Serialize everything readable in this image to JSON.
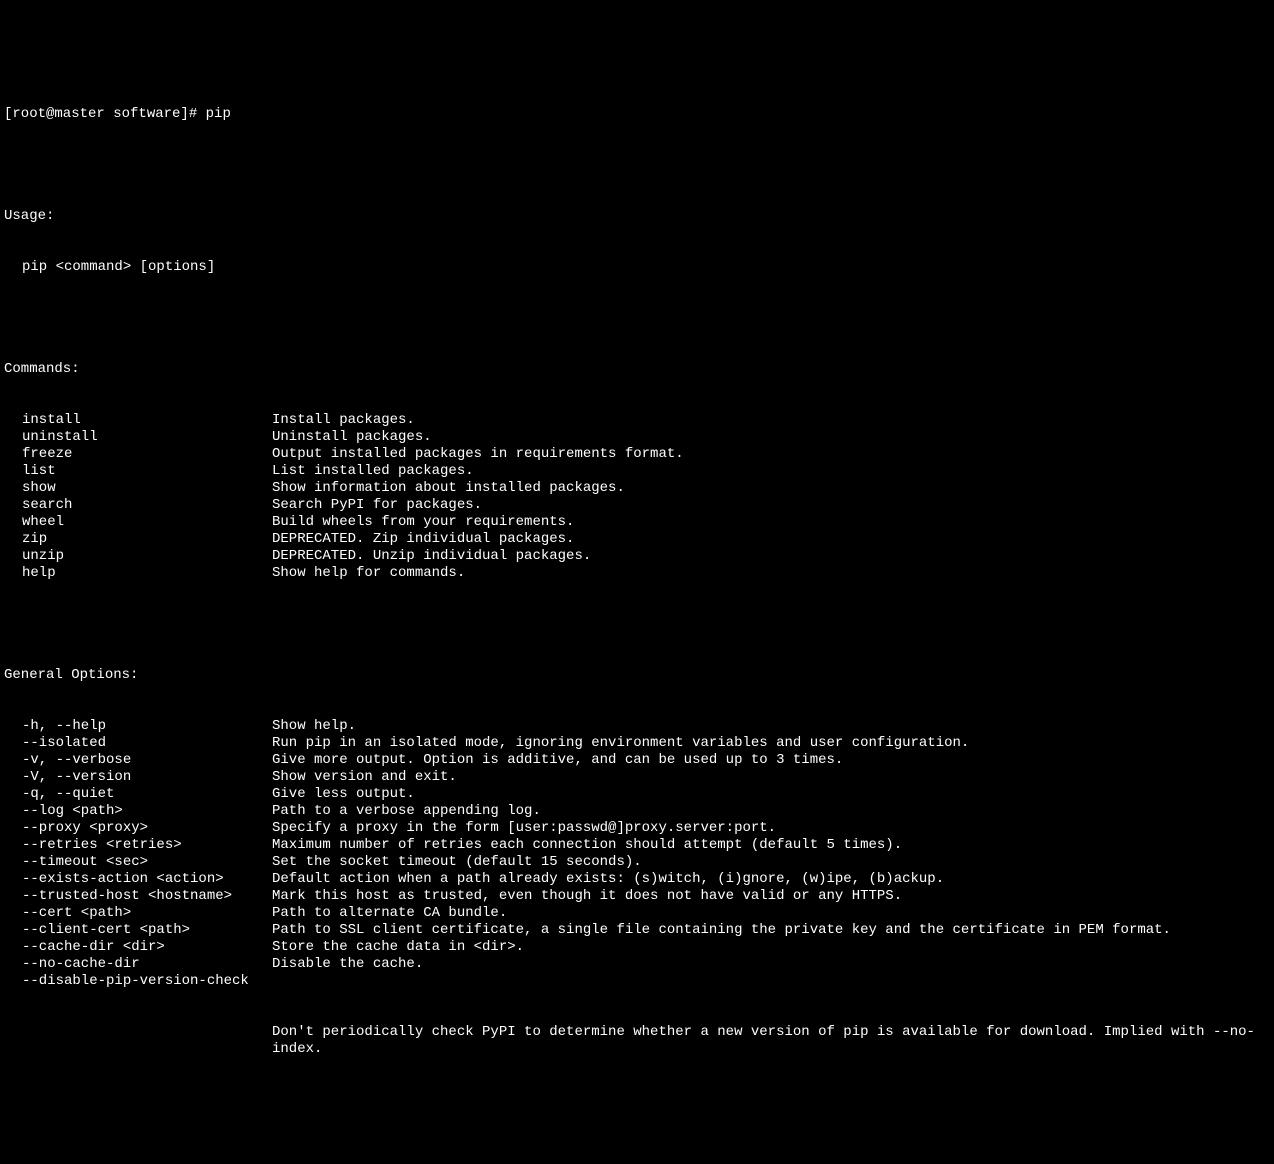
{
  "prompt": "[root@master software]# ",
  "command": "pip",
  "usage_header": "Usage:",
  "usage_line": "pip <command> [options]",
  "commands_header": "Commands:",
  "commands": [
    {
      "name": "install",
      "desc": "Install packages."
    },
    {
      "name": "uninstall",
      "desc": "Uninstall packages."
    },
    {
      "name": "freeze",
      "desc": "Output installed packages in requirements format."
    },
    {
      "name": "list",
      "desc": "List installed packages."
    },
    {
      "name": "show",
      "desc": "Show information about installed packages."
    },
    {
      "name": "search",
      "desc": "Search PyPI for packages."
    },
    {
      "name": "wheel",
      "desc": "Build wheels from your requirements."
    },
    {
      "name": "zip",
      "desc": "DEPRECATED. Zip individual packages."
    },
    {
      "name": "unzip",
      "desc": "DEPRECATED. Unzip individual packages."
    },
    {
      "name": "help",
      "desc": "Show help for commands."
    }
  ],
  "options_header": "General Options:",
  "options": [
    {
      "name": "-h, --help",
      "desc": "Show help."
    },
    {
      "name": "--isolated",
      "desc": "Run pip in an isolated mode, ignoring environment variables and user configuration."
    },
    {
      "name": "-v, --verbose",
      "desc": "Give more output. Option is additive, and can be used up to 3 times."
    },
    {
      "name": "-V, --version",
      "desc": "Show version and exit."
    },
    {
      "name": "-q, --quiet",
      "desc": "Give less output."
    },
    {
      "name": "--log <path>",
      "desc": "Path to a verbose appending log."
    },
    {
      "name": "--proxy <proxy>",
      "desc": "Specify a proxy in the form [user:passwd@]proxy.server:port."
    },
    {
      "name": "--retries <retries>",
      "desc": "Maximum number of retries each connection should attempt (default 5 times)."
    },
    {
      "name": "--timeout <sec>",
      "desc": "Set the socket timeout (default 15 seconds)."
    },
    {
      "name": "--exists-action <action>",
      "desc": "Default action when a path already exists: (s)witch, (i)gnore, (w)ipe, (b)ackup."
    },
    {
      "name": "--trusted-host <hostname>",
      "desc": "Mark this host as trusted, even though it does not have valid or any HTTPS."
    },
    {
      "name": "--cert <path>",
      "desc": "Path to alternate CA bundle."
    },
    {
      "name": "--client-cert <path>",
      "desc": "Path to SSL client certificate, a single file containing the private key and the certificate in PEM format."
    },
    {
      "name": "--cache-dir <dir>",
      "desc": "Store the cache data in <dir>."
    },
    {
      "name": "--no-cache-dir",
      "desc": "Disable the cache."
    },
    {
      "name": "--disable-pip-version-check",
      "desc": ""
    }
  ],
  "wrapped_desc": "Don't periodically check PyPI to determine whether a new version of pip is available for download. Implied with --no-index."
}
